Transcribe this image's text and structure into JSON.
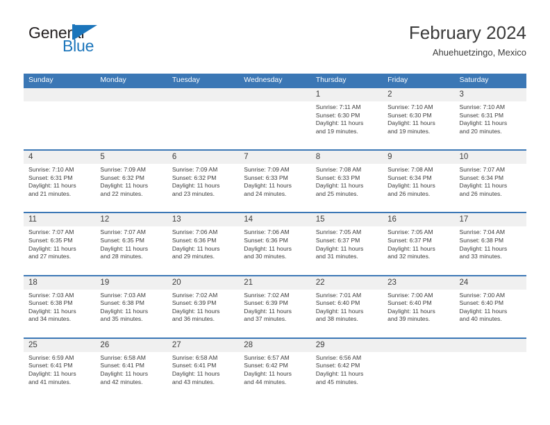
{
  "brand": {
    "name_part1": "General",
    "name_part2": "Blue",
    "mark_icon": "triangle-flag-icon",
    "colors": {
      "dark": "#231f20",
      "blue": "#1b75bb"
    }
  },
  "header": {
    "title": "February 2024",
    "subtitle": "Ahuehuetzingo, Mexico"
  },
  "theme": {
    "header_bar": "#3b77b5",
    "number_band": "#f0f0f0",
    "text": "#3b3b3b"
  },
  "calendar": {
    "weekdays": [
      "Sunday",
      "Monday",
      "Tuesday",
      "Wednesday",
      "Thursday",
      "Friday",
      "Saturday"
    ],
    "weeks": [
      [
        {
          "day": "",
          "sunrise": "",
          "sunset": "",
          "daylight1": "",
          "daylight2": ""
        },
        {
          "day": "",
          "sunrise": "",
          "sunset": "",
          "daylight1": "",
          "daylight2": ""
        },
        {
          "day": "",
          "sunrise": "",
          "sunset": "",
          "daylight1": "",
          "daylight2": ""
        },
        {
          "day": "",
          "sunrise": "",
          "sunset": "",
          "daylight1": "",
          "daylight2": ""
        },
        {
          "day": "1",
          "sunrise": "Sunrise: 7:11 AM",
          "sunset": "Sunset: 6:30 PM",
          "daylight1": "Daylight: 11 hours",
          "daylight2": "and 19 minutes."
        },
        {
          "day": "2",
          "sunrise": "Sunrise: 7:10 AM",
          "sunset": "Sunset: 6:30 PM",
          "daylight1": "Daylight: 11 hours",
          "daylight2": "and 19 minutes."
        },
        {
          "day": "3",
          "sunrise": "Sunrise: 7:10 AM",
          "sunset": "Sunset: 6:31 PM",
          "daylight1": "Daylight: 11 hours",
          "daylight2": "and 20 minutes."
        }
      ],
      [
        {
          "day": "4",
          "sunrise": "Sunrise: 7:10 AM",
          "sunset": "Sunset: 6:31 PM",
          "daylight1": "Daylight: 11 hours",
          "daylight2": "and 21 minutes."
        },
        {
          "day": "5",
          "sunrise": "Sunrise: 7:09 AM",
          "sunset": "Sunset: 6:32 PM",
          "daylight1": "Daylight: 11 hours",
          "daylight2": "and 22 minutes."
        },
        {
          "day": "6",
          "sunrise": "Sunrise: 7:09 AM",
          "sunset": "Sunset: 6:32 PM",
          "daylight1": "Daylight: 11 hours",
          "daylight2": "and 23 minutes."
        },
        {
          "day": "7",
          "sunrise": "Sunrise: 7:09 AM",
          "sunset": "Sunset: 6:33 PM",
          "daylight1": "Daylight: 11 hours",
          "daylight2": "and 24 minutes."
        },
        {
          "day": "8",
          "sunrise": "Sunrise: 7:08 AM",
          "sunset": "Sunset: 6:33 PM",
          "daylight1": "Daylight: 11 hours",
          "daylight2": "and 25 minutes."
        },
        {
          "day": "9",
          "sunrise": "Sunrise: 7:08 AM",
          "sunset": "Sunset: 6:34 PM",
          "daylight1": "Daylight: 11 hours",
          "daylight2": "and 26 minutes."
        },
        {
          "day": "10",
          "sunrise": "Sunrise: 7:07 AM",
          "sunset": "Sunset: 6:34 PM",
          "daylight1": "Daylight: 11 hours",
          "daylight2": "and 26 minutes."
        }
      ],
      [
        {
          "day": "11",
          "sunrise": "Sunrise: 7:07 AM",
          "sunset": "Sunset: 6:35 PM",
          "daylight1": "Daylight: 11 hours",
          "daylight2": "and 27 minutes."
        },
        {
          "day": "12",
          "sunrise": "Sunrise: 7:07 AM",
          "sunset": "Sunset: 6:35 PM",
          "daylight1": "Daylight: 11 hours",
          "daylight2": "and 28 minutes."
        },
        {
          "day": "13",
          "sunrise": "Sunrise: 7:06 AM",
          "sunset": "Sunset: 6:36 PM",
          "daylight1": "Daylight: 11 hours",
          "daylight2": "and 29 minutes."
        },
        {
          "day": "14",
          "sunrise": "Sunrise: 7:06 AM",
          "sunset": "Sunset: 6:36 PM",
          "daylight1": "Daylight: 11 hours",
          "daylight2": "and 30 minutes."
        },
        {
          "day": "15",
          "sunrise": "Sunrise: 7:05 AM",
          "sunset": "Sunset: 6:37 PM",
          "daylight1": "Daylight: 11 hours",
          "daylight2": "and 31 minutes."
        },
        {
          "day": "16",
          "sunrise": "Sunrise: 7:05 AM",
          "sunset": "Sunset: 6:37 PM",
          "daylight1": "Daylight: 11 hours",
          "daylight2": "and 32 minutes."
        },
        {
          "day": "17",
          "sunrise": "Sunrise: 7:04 AM",
          "sunset": "Sunset: 6:38 PM",
          "daylight1": "Daylight: 11 hours",
          "daylight2": "and 33 minutes."
        }
      ],
      [
        {
          "day": "18",
          "sunrise": "Sunrise: 7:03 AM",
          "sunset": "Sunset: 6:38 PM",
          "daylight1": "Daylight: 11 hours",
          "daylight2": "and 34 minutes."
        },
        {
          "day": "19",
          "sunrise": "Sunrise: 7:03 AM",
          "sunset": "Sunset: 6:38 PM",
          "daylight1": "Daylight: 11 hours",
          "daylight2": "and 35 minutes."
        },
        {
          "day": "20",
          "sunrise": "Sunrise: 7:02 AM",
          "sunset": "Sunset: 6:39 PM",
          "daylight1": "Daylight: 11 hours",
          "daylight2": "and 36 minutes."
        },
        {
          "day": "21",
          "sunrise": "Sunrise: 7:02 AM",
          "sunset": "Sunset: 6:39 PM",
          "daylight1": "Daylight: 11 hours",
          "daylight2": "and 37 minutes."
        },
        {
          "day": "22",
          "sunrise": "Sunrise: 7:01 AM",
          "sunset": "Sunset: 6:40 PM",
          "daylight1": "Daylight: 11 hours",
          "daylight2": "and 38 minutes."
        },
        {
          "day": "23",
          "sunrise": "Sunrise: 7:00 AM",
          "sunset": "Sunset: 6:40 PM",
          "daylight1": "Daylight: 11 hours",
          "daylight2": "and 39 minutes."
        },
        {
          "day": "24",
          "sunrise": "Sunrise: 7:00 AM",
          "sunset": "Sunset: 6:40 PM",
          "daylight1": "Daylight: 11 hours",
          "daylight2": "and 40 minutes."
        }
      ],
      [
        {
          "day": "25",
          "sunrise": "Sunrise: 6:59 AM",
          "sunset": "Sunset: 6:41 PM",
          "daylight1": "Daylight: 11 hours",
          "daylight2": "and 41 minutes."
        },
        {
          "day": "26",
          "sunrise": "Sunrise: 6:58 AM",
          "sunset": "Sunset: 6:41 PM",
          "daylight1": "Daylight: 11 hours",
          "daylight2": "and 42 minutes."
        },
        {
          "day": "27",
          "sunrise": "Sunrise: 6:58 AM",
          "sunset": "Sunset: 6:41 PM",
          "daylight1": "Daylight: 11 hours",
          "daylight2": "and 43 minutes."
        },
        {
          "day": "28",
          "sunrise": "Sunrise: 6:57 AM",
          "sunset": "Sunset: 6:42 PM",
          "daylight1": "Daylight: 11 hours",
          "daylight2": "and 44 minutes."
        },
        {
          "day": "29",
          "sunrise": "Sunrise: 6:56 AM",
          "sunset": "Sunset: 6:42 PM",
          "daylight1": "Daylight: 11 hours",
          "daylight2": "and 45 minutes."
        },
        {
          "day": "",
          "sunrise": "",
          "sunset": "",
          "daylight1": "",
          "daylight2": ""
        },
        {
          "day": "",
          "sunrise": "",
          "sunset": "",
          "daylight1": "",
          "daylight2": ""
        }
      ]
    ]
  }
}
